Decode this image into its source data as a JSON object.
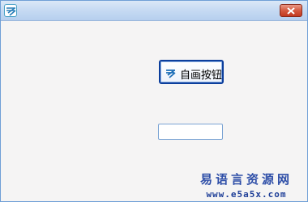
{
  "window": {
    "icon": "app-logo-icon"
  },
  "titlebar": {
    "close_icon": "close-icon"
  },
  "main": {
    "button": {
      "label": "自画按钮",
      "icon": "app-logo-icon"
    },
    "input": {
      "value": ""
    }
  },
  "watermark": {
    "name": "易语言资源网",
    "url": "www.e5a5x.com"
  }
}
